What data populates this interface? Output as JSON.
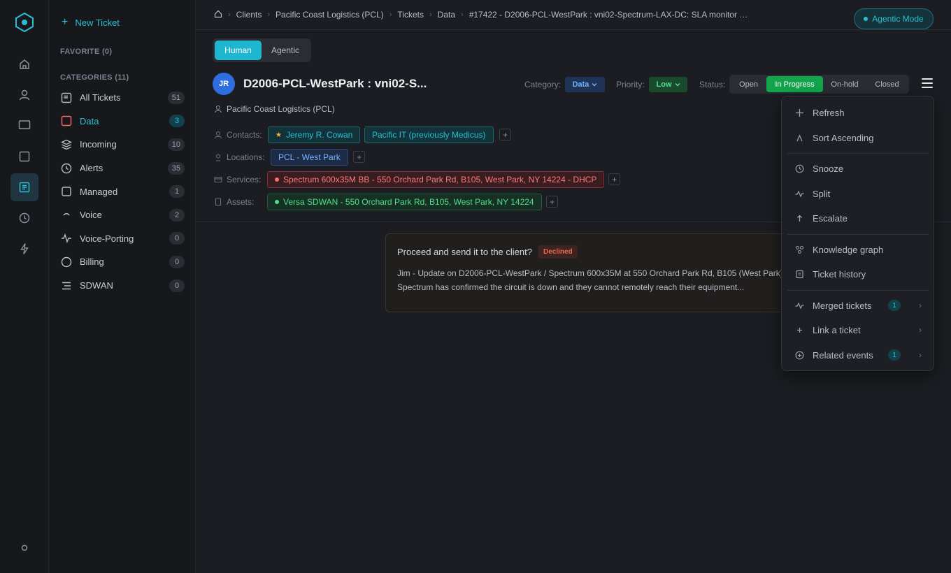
{
  "sidebar": {
    "new_ticket": "New Ticket",
    "favorite_header": "FAVORITE (0)",
    "categories_header": "CATEGORIES (11)",
    "categories": [
      {
        "label": "All Tickets",
        "count": "51",
        "icon": "ticket-icon"
      },
      {
        "label": "Data",
        "count": "3",
        "icon": "square-icon",
        "active": true
      },
      {
        "label": "Incoming",
        "count": "10",
        "icon": "layers-icon"
      },
      {
        "label": "Alerts",
        "count": "35",
        "icon": "clock-icon"
      },
      {
        "label": "Managed",
        "count": "1",
        "icon": "square-icon"
      },
      {
        "label": "Voice",
        "count": "2",
        "icon": "wave-icon"
      },
      {
        "label": "Voice-Porting",
        "count": "0",
        "icon": "pulse-icon"
      },
      {
        "label": "Billing",
        "count": "0",
        "icon": "circle-icon"
      },
      {
        "label": "SDWAN",
        "count": "0",
        "icon": "lines-icon"
      }
    ]
  },
  "breadcrumb": {
    "items": [
      "Clients",
      "Pacific Coast Logistics (PCL)",
      "Tickets",
      "Data",
      "#17422 - D2006-PCL-WestPark : vni02-Spectrum-LAX-DC: SLA monitor …"
    ]
  },
  "agentic_mode": "Agentic Mode",
  "mode_toggle": {
    "human": "Human",
    "agentic": "Agentic"
  },
  "ticket": {
    "avatar": "JR",
    "title": "D2006-PCL-WestPark : vni02-S...",
    "category_label": "Category:",
    "category_value": "Data",
    "priority_label": "Priority:",
    "priority_value": "Low",
    "status_label": "Status:",
    "statuses": [
      "Open",
      "In Progress",
      "On-hold",
      "Closed"
    ],
    "active_status": "In Progress",
    "client": "Pacific Coast Logistics (PCL)",
    "contacts_label": "Contacts:",
    "contacts": [
      "Jeremy R. Cowan",
      "Pacific IT (previously Medicus)"
    ],
    "locations_label": "Locations:",
    "location": "PCL - West Park",
    "services_label": "Services:",
    "service": "Spectrum 600x35M BB - 550 Orchard Park Rd, B105, West Park, NY 14224 - DHCP",
    "assets_label": "Assets:",
    "asset": "Versa SDWAN - 550 Orchard Park Rd, B105, West Park, NY 14224"
  },
  "message": {
    "question": "Proceed and send it to the client?",
    "status": "Declined",
    "body": "Jim - Update on D2006-PCL-WestPark / Spectrum 600x35M at 550 Orchard Park Rd, B105 (West Park) - Spectrum has confirmed the circuit is down and they cannot remotely reach their equipment..."
  },
  "menu": {
    "refresh": "Refresh",
    "sort": "Sort Ascending",
    "snooze": "Snooze",
    "split": "Split",
    "escalate": "Escalate",
    "knowledge_graph": "Knowledge graph",
    "ticket_history": "Ticket history",
    "merged_tickets": "Merged tickets",
    "merged_count": "1",
    "link_ticket": "Link a ticket",
    "related_events": "Related events",
    "related_count": "1"
  },
  "colors": {
    "accent": "#2bbfd6",
    "in_progress": "#12a54b",
    "declined": "#e86a4f"
  }
}
